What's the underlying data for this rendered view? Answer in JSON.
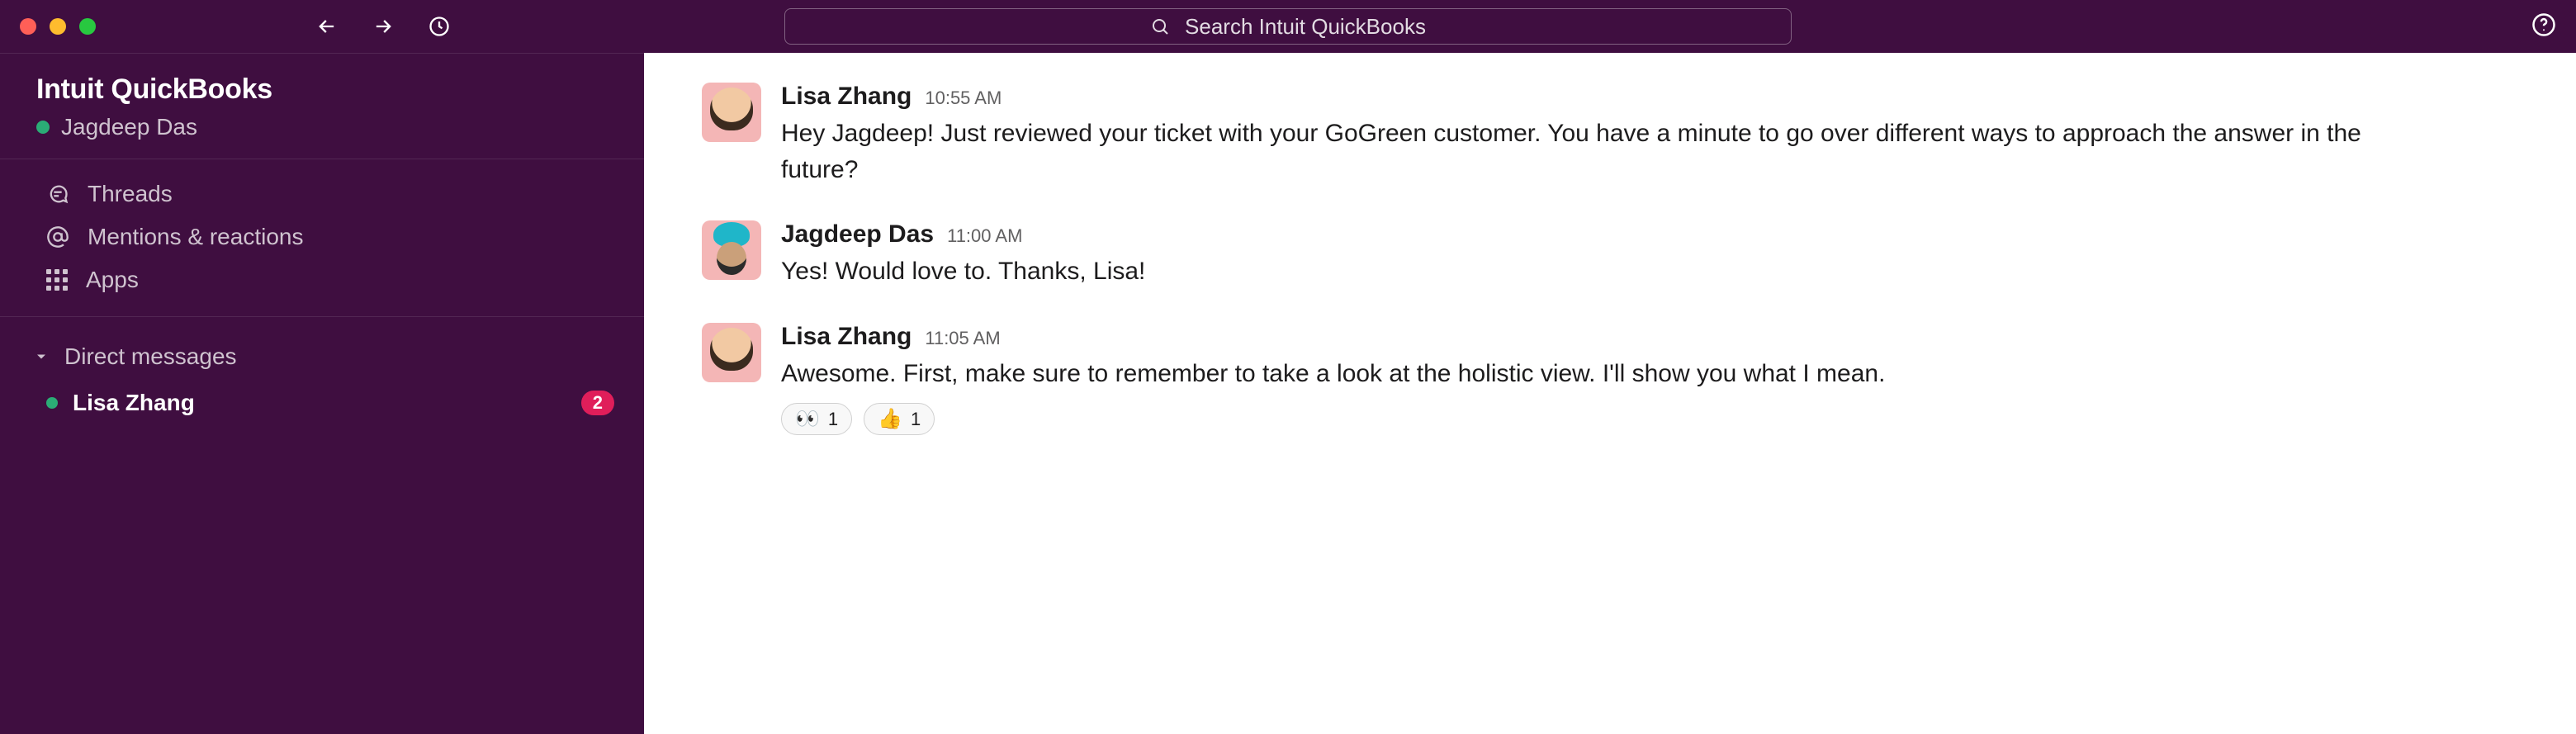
{
  "titlebar": {
    "search_placeholder": "Search Intuit QuickBooks"
  },
  "sidebar": {
    "workspace_name": "Intuit QuickBooks",
    "current_user": "Jagdeep Das",
    "nav": {
      "threads": "Threads",
      "mentions": "Mentions & reactions",
      "apps": "Apps"
    },
    "dm_section_label": "Direct messages",
    "dms": [
      {
        "name": "Lisa Zhang",
        "badge": "2"
      }
    ]
  },
  "messages": [
    {
      "author": "Lisa Zhang",
      "time": "10:55 AM",
      "avatar": "lisa",
      "text": "Hey Jagdeep! Just reviewed your ticket with your GoGreen customer. You have a minute to go over different ways to approach the answer in the future?",
      "reactions": []
    },
    {
      "author": "Jagdeep Das",
      "time": "11:00 AM",
      "avatar": "jagdeep",
      "text": "Yes! Would love to. Thanks, Lisa!",
      "reactions": []
    },
    {
      "author": "Lisa Zhang",
      "time": "11:05 AM",
      "avatar": "lisa",
      "text": "Awesome. First, make sure to remember to take a look at the holistic view. I'll show you what I mean.",
      "reactions": [
        {
          "emoji": "👀",
          "count": "1"
        },
        {
          "emoji": "👍",
          "count": "1"
        }
      ]
    }
  ]
}
